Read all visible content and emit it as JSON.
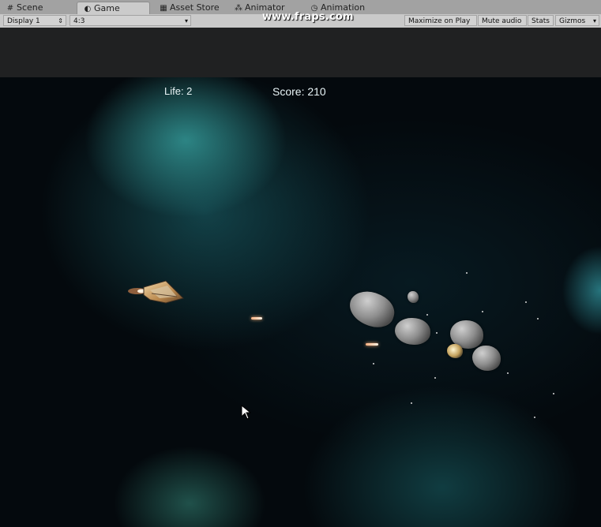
{
  "tabs": [
    {
      "label": "Scene",
      "icon": "grid-icon"
    },
    {
      "label": "Game",
      "icon": "pacman-icon"
    },
    {
      "label": "Asset Store",
      "icon": "store-icon"
    },
    {
      "label": "Animator",
      "icon": "animator-icon"
    },
    {
      "label": "Animation",
      "icon": "clock-icon"
    }
  ],
  "watermark": "www.fraps.com",
  "toolbar": {
    "display": "Display 1",
    "aspect": "4:3",
    "maximize_on_play": "Maximize on Play",
    "mute_audio": "Mute audio",
    "stats": "Stats",
    "gizmos": "Gizmos"
  },
  "game": {
    "life": "Life: 2",
    "score": "Score: 210"
  },
  "colors": {
    "nebula": "#2a8f95",
    "space": "#04090d",
    "tab_bar": "#a2a2a2",
    "toolbar": "#c9c9c9"
  }
}
